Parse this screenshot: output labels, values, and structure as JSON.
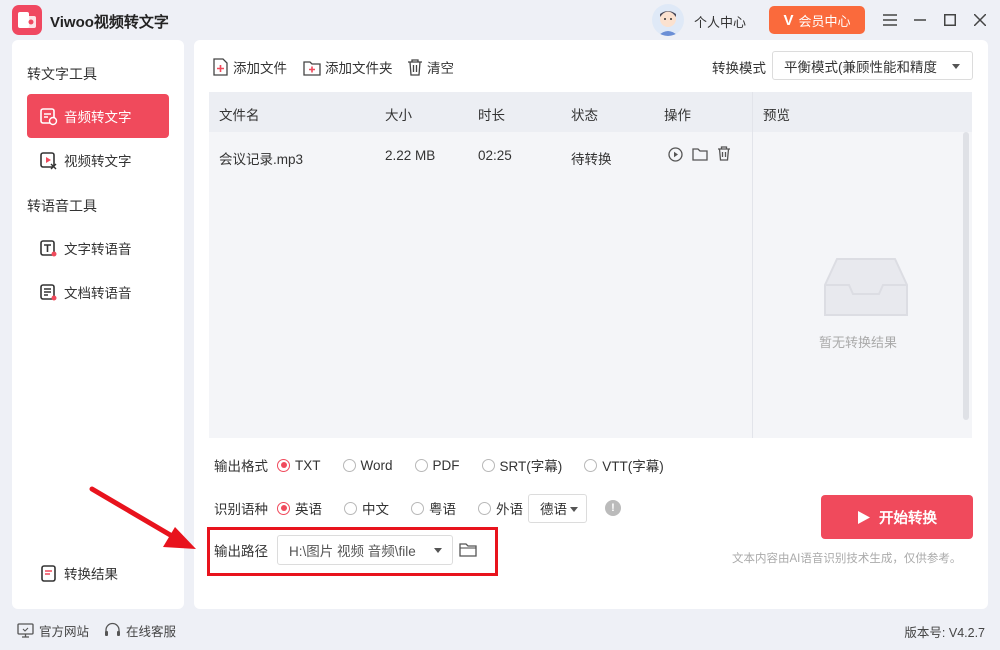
{
  "app": {
    "title": "Viwoo视频转文字"
  },
  "header": {
    "personal_center": "个人中心",
    "vip_label": "会员中心",
    "vip_mark": "V"
  },
  "sidebar": {
    "group1": "转文字工具",
    "items1": [
      {
        "label": "音频转文字"
      },
      {
        "label": "视频转文字"
      }
    ],
    "group2": "转语音工具",
    "items2": [
      {
        "label": "文字转语音"
      },
      {
        "label": "文档转语音"
      }
    ],
    "result_label": "转换结果"
  },
  "toolbar": {
    "add_file": "添加文件",
    "add_folder": "添加文件夹",
    "clear": "清空",
    "mode_label": "转换模式",
    "mode_value": "平衡模式(兼顾性能和精度"
  },
  "table": {
    "headers": {
      "name": "文件名",
      "size": "大小",
      "duration": "时长",
      "status": "状态",
      "actions": "操作"
    },
    "rows": [
      {
        "name": "会议记录.mp3",
        "size": "2.22 MB",
        "duration": "02:25",
        "status": "待转换"
      }
    ]
  },
  "preview": {
    "title": "预览",
    "empty": "暂无转换结果"
  },
  "options": {
    "format_label": "输出格式",
    "formats": [
      "TXT",
      "Word",
      "PDF",
      "SRT(字幕)",
      "VTT(字幕)"
    ],
    "format_selected": "TXT",
    "lang_label": "识别语种",
    "langs": [
      "英语",
      "中文",
      "粤语",
      "外语"
    ],
    "lang_selected": "英语",
    "foreign_value": "德语",
    "path_label": "输出路径",
    "path_value": "H:\\图片 视频 音频\\file"
  },
  "actions": {
    "start": "开始转换",
    "disclaimer": "文本内容由AI语音识别技术生成，仅供参考。"
  },
  "footer": {
    "website": "官方网站",
    "support": "在线客服",
    "version": "版本号: V4.2.7"
  },
  "colors": {
    "accent": "#f04a5c",
    "vip": "#fa6a3c",
    "annotation": "#e8131d"
  }
}
